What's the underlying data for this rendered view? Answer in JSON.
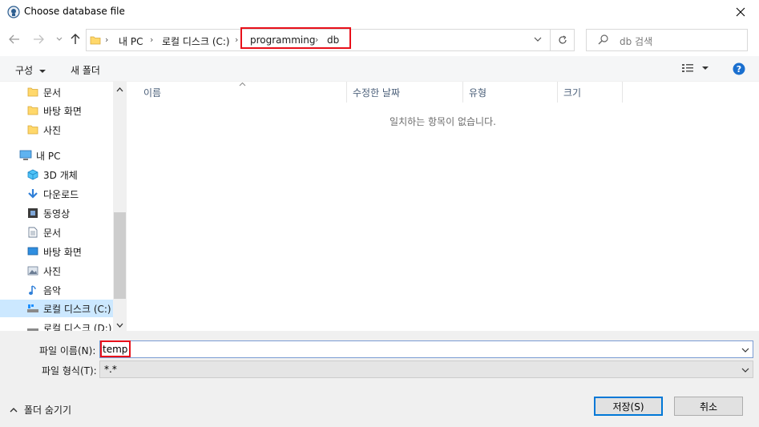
{
  "window": {
    "title": "Choose database file",
    "close_icon": "close-icon"
  },
  "address": {
    "crumbs": [
      "내 PC",
      "로컬 디스크 (C:)",
      "programming",
      "db"
    ],
    "search_placeholder": "db 검색"
  },
  "toolbar": {
    "organize_label": "구성",
    "new_folder_label": "새 폴더"
  },
  "nav": {
    "items": [
      {
        "label": "문서",
        "icon": "folder-icon"
      },
      {
        "label": "바탕 화면",
        "icon": "folder-icon"
      },
      {
        "label": "사진",
        "icon": "folder-icon"
      },
      {
        "label": "내 PC",
        "icon": "computer-icon"
      },
      {
        "label": "3D 개체",
        "icon": "3d-objects-icon"
      },
      {
        "label": "다운로드",
        "icon": "download-icon"
      },
      {
        "label": "동영상",
        "icon": "video-icon"
      },
      {
        "label": "문서",
        "icon": "document-icon"
      },
      {
        "label": "바탕 화면",
        "icon": "desktop-icon"
      },
      {
        "label": "사진",
        "icon": "picture-icon"
      },
      {
        "label": "음악",
        "icon": "music-icon"
      },
      {
        "label": "로컬 디스크 (C:)",
        "icon": "drive-icon"
      },
      {
        "label": "로컬 디스크 (D:)",
        "icon": "drive-icon"
      }
    ]
  },
  "content": {
    "columns": [
      "이름",
      "수정한 날짜",
      "유형",
      "크기"
    ],
    "empty_message": "일치하는 항목이 없습니다."
  },
  "form": {
    "filename_label": "파일 이름(N):",
    "filename_value": "temp",
    "filetype_label": "파일 형식(T):",
    "filetype_value": "*.*"
  },
  "buttons": {
    "save_label": "저장(S)",
    "cancel_label": "취소",
    "hide_folders_label": "폴더 숨기기"
  },
  "colors": {
    "highlight": "#e8101a",
    "selection": "#cce8ff",
    "accent": "#0078d7",
    "folder": "#ffd86b"
  }
}
